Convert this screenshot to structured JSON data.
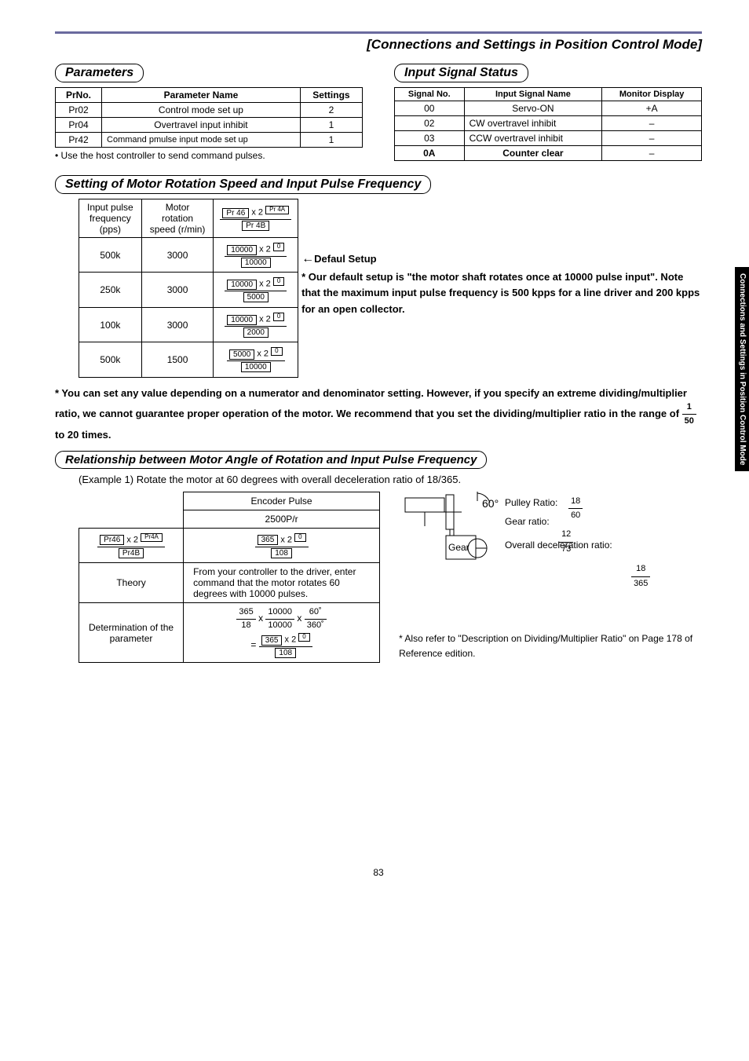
{
  "header": {
    "title": "[Connections and Settings in Position Control Mode]"
  },
  "side_tab": "Connections and\nSettings in Position\nControl Mode",
  "parameters": {
    "heading": "Parameters",
    "columns": [
      "PrNo.",
      "Parameter Name",
      "Settings"
    ],
    "rows": [
      {
        "no": "Pr02",
        "name": "Control mode set up",
        "setting": "2"
      },
      {
        "no": "Pr04",
        "name": "Overtravel input inhibit",
        "setting": "1"
      },
      {
        "no": "Pr42",
        "name": "Command pmulse input mode set up",
        "setting": "1"
      }
    ],
    "note": "• Use the host controller to send command pulses."
  },
  "input_signal": {
    "heading": "Input Signal Status",
    "columns": [
      "Signal No.",
      "Input Signal Name",
      "Monitor Display"
    ],
    "rows": [
      {
        "no": "00",
        "name": "Servo-ON",
        "disp": "+A"
      },
      {
        "no": "02",
        "name": "CW overtravel inhibit",
        "disp": "–"
      },
      {
        "no": "03",
        "name": "CCW overtravel inhibit",
        "disp": "–"
      },
      {
        "no": "0A",
        "name": "Counter clear",
        "disp": "–",
        "bold": true
      }
    ]
  },
  "rotation_speed": {
    "heading": "Setting of Motor Rotation Speed and Input Pulse Frequency",
    "header": {
      "col1_l1": "Input pulse",
      "col1_l2": "frequency",
      "col1_l3": "(pps)",
      "col2_l1": "Motor",
      "col2_l2": "rotation",
      "col2_l3": "speed (r/min)",
      "formula_num": "Pr 46",
      "formula_x2": " x 2 ",
      "formula_exp": "Pr 4A",
      "formula_den": "Pr 4B"
    },
    "rows": [
      {
        "pps": "500k",
        "speed": "3000",
        "num": "10000",
        "exp": "0",
        "den": "10000"
      },
      {
        "pps": "250k",
        "speed": "3000",
        "num": "10000",
        "exp": "0",
        "den": "5000"
      },
      {
        "pps": "100k",
        "speed": "3000",
        "num": "10000",
        "exp": "0",
        "den": "2000"
      },
      {
        "pps": "500k",
        "speed": "1500",
        "num": "5000",
        "exp": "0",
        "den": "10000"
      }
    ],
    "defaul_label": "Defaul Setup",
    "defaul_note": "*  Our default setup is \"the motor shaft rotates once at 10000 pulse input\".  Note that the maximum input pulse frequency is 500 kpps for a line driver and 200 kpps for an open collector."
  },
  "note_star": {
    "prefix": "*   You can set any value depending on a numerator and denominator setting. However, if you specify an extreme dividing/multiplier ratio, we cannot guarantee proper operation of the motor.  We recommend that you set the dividing/multiplier ratio in the range of ",
    "frac_num": "1",
    "frac_den": "50",
    "suffix": " to 20 times."
  },
  "relationship": {
    "heading": "Relationship between Motor Angle of Rotation and Input Pulse Frequency",
    "example": "(Example 1) Rotate the motor at 60 degrees with overall deceleration ratio of 18/365.",
    "encoder_h1": "Encoder Pulse",
    "encoder_h2": "2500P/r",
    "row1_left_num": "Pr46",
    "row1_left_x2": " x 2 ",
    "row1_left_exp": "Pr4A",
    "row1_left_den": "Pr4B",
    "row1_right_num": "365",
    "row1_right_x2": " x 2 ",
    "row1_right_exp": "0",
    "row1_right_den": "108",
    "theory_label": "Theory",
    "theory_text": "From your controller to the driver, enter command that the motor rotates 60 degrees with 10000 pulses.",
    "det_label_l1": "Determination of the",
    "det_label_l2": "parameter",
    "det_frac1_num": "365",
    "det_frac1_den": "18",
    "det_x1": " x ",
    "det_frac2_num": "10000",
    "det_frac2_den": "10000",
    "det_x2": " x ",
    "det_frac3_num": "60˚",
    "det_frac3_den": "360˚",
    "det_eq": "= ",
    "det_res_num": "365",
    "det_res_x2": " x 2 ",
    "det_res_exp": "0",
    "det_res_den": "108"
  },
  "gear": {
    "angle": "60°",
    "gear_label": "Gear",
    "pulley_label": "Pulley Ratio:",
    "pulley_num": "18",
    "pulley_den": "60",
    "gear_ratio_label": "Gear ratio:",
    "gear_num": "12",
    "gear_den": "73",
    "overall_label": "Overall deceleration ratio:",
    "overall_num": "18",
    "overall_den": "365"
  },
  "also_refer": "*   Also refer to \"Description on Dividing/Multiplier Ratio\" on Page 178 of Reference edition.",
  "page_number": "83"
}
